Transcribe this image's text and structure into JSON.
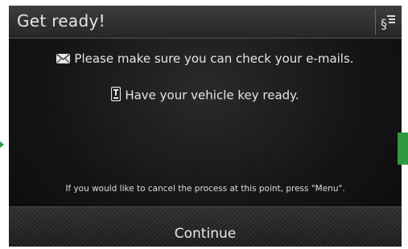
{
  "header": {
    "title": "Get ready!",
    "settings_icon": "settings-list-icon"
  },
  "messages": [
    {
      "icon": "envelope-icon",
      "text": "Please make sure you can check your e-mails."
    },
    {
      "icon": "key-icon",
      "text": "Have your vehicle key ready."
    }
  ],
  "cancel_note": "If you would like to cancel the process at this point, press \"Menu\".",
  "continue_label": "Continue",
  "colors": {
    "accent": "#2f9a3f",
    "background": "#151515",
    "text": "#e6e6e6"
  }
}
